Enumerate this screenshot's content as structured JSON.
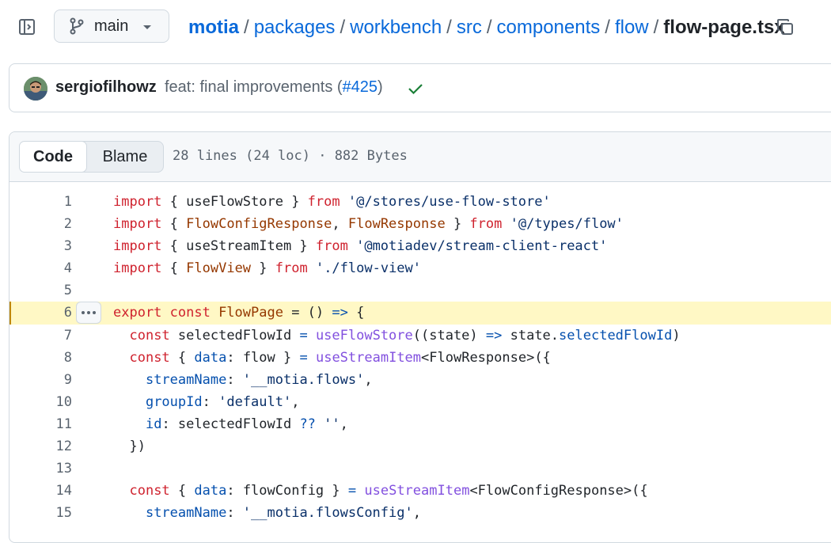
{
  "header": {
    "branch": "main",
    "breadcrumb": {
      "repo": "motia",
      "dirs": [
        "packages",
        "workbench",
        "src",
        "components",
        "flow"
      ],
      "file": "flow-page.tsx",
      "separator": "/"
    }
  },
  "commit": {
    "author": "sergiofilhowz",
    "message_prefix": "feat: final improvements (",
    "pr": "#425",
    "message_suffix": ")",
    "status": "success"
  },
  "file": {
    "tabs": [
      "Code",
      "Blame"
    ],
    "active_tab": "Code",
    "meta": "28 lines (24 loc) · 882 Bytes"
  },
  "code": {
    "highlighted_line": 6,
    "lines": [
      {
        "n": "1",
        "tokens": [
          [
            "kw",
            "import"
          ],
          [
            "",
            "{ useFlowStore } "
          ],
          [
            "kw",
            "from"
          ],
          [
            "",
            ""
          ],
          [
            "str",
            " '@/stores/use-flow-store'"
          ]
        ]
      },
      {
        "n": "2",
        "tokens": [
          [
            "kw",
            "import"
          ],
          [
            "",
            "{ "
          ],
          [
            "ent",
            "FlowConfigResponse"
          ],
          [
            "",
            ", "
          ],
          [
            "ent",
            "FlowResponse"
          ],
          [
            "",
            " } "
          ],
          [
            "kw",
            "from"
          ],
          [
            "str",
            " '@/types/flow'"
          ]
        ]
      },
      {
        "n": "3",
        "tokens": [
          [
            "kw",
            "import"
          ],
          [
            "",
            "{ useStreamItem } "
          ],
          [
            "kw",
            "from"
          ],
          [
            "str",
            " '@motiadev/stream-client-react'"
          ]
        ]
      },
      {
        "n": "4",
        "tokens": [
          [
            "kw",
            "import"
          ],
          [
            "",
            "{ "
          ],
          [
            "ent",
            "FlowView"
          ],
          [
            "",
            " } "
          ],
          [
            "kw",
            "from"
          ],
          [
            "str",
            " './flow-view'"
          ]
        ]
      },
      {
        "n": "5",
        "tokens": []
      },
      {
        "n": "6",
        "tokens": [
          [
            "kw",
            "export const "
          ],
          [
            "ent",
            "FlowPage"
          ],
          [
            "",
            " = () "
          ],
          [
            "op",
            "=>"
          ],
          [
            "",
            " {"
          ]
        ]
      },
      {
        "n": "7",
        "tokens": [
          [
            "",
            "  "
          ],
          [
            "kw",
            "const"
          ],
          [
            "",
            " selectedFlowId "
          ],
          [
            "op",
            "="
          ],
          [
            "",
            " "
          ],
          [
            "fn",
            "useFlowStore"
          ],
          [
            "",
            "((state) "
          ],
          [
            "op",
            "=>"
          ],
          [
            "",
            " state."
          ],
          [
            "prop",
            "selectedFlowId"
          ],
          [
            "",
            ")"
          ]
        ]
      },
      {
        "n": "8",
        "tokens": [
          [
            "",
            "  "
          ],
          [
            "kw",
            "const"
          ],
          [
            "",
            " { "
          ],
          [
            "prop",
            "data"
          ],
          [
            "",
            ": flow } "
          ],
          [
            "op",
            "="
          ],
          [
            "",
            " "
          ],
          [
            "fn",
            "useStreamItem"
          ],
          [
            "",
            "<FlowResponse>({"
          ]
        ]
      },
      {
        "n": "9",
        "tokens": [
          [
            "",
            "    "
          ],
          [
            "prop",
            "streamName"
          ],
          [
            "",
            ": "
          ],
          [
            "str",
            "'__motia.flows'"
          ],
          [
            "",
            ","
          ]
        ]
      },
      {
        "n": "10",
        "tokens": [
          [
            "",
            "    "
          ],
          [
            "prop",
            "groupId"
          ],
          [
            "",
            ": "
          ],
          [
            "str",
            "'default'"
          ],
          [
            "",
            ","
          ]
        ]
      },
      {
        "n": "11",
        "tokens": [
          [
            "",
            "    "
          ],
          [
            "prop",
            "id"
          ],
          [
            "",
            ": selectedFlowId "
          ],
          [
            "op",
            "??"
          ],
          [
            "",
            " "
          ],
          [
            "str",
            "''"
          ],
          [
            "",
            ","
          ]
        ]
      },
      {
        "n": "12",
        "tokens": [
          [
            "",
            "  })"
          ]
        ]
      },
      {
        "n": "13",
        "tokens": []
      },
      {
        "n": "14",
        "tokens": [
          [
            "",
            "  "
          ],
          [
            "kw",
            "const"
          ],
          [
            "",
            " { "
          ],
          [
            "prop",
            "data"
          ],
          [
            "",
            ": flowConfig } "
          ],
          [
            "op",
            "="
          ],
          [
            "",
            " "
          ],
          [
            "fn",
            "useStreamItem"
          ],
          [
            "",
            "<FlowConfigResponse>({"
          ]
        ]
      },
      {
        "n": "15",
        "tokens": [
          [
            "",
            "    "
          ],
          [
            "prop",
            "streamName"
          ],
          [
            "",
            ": "
          ],
          [
            "str",
            "'__motia.flowsConfig'"
          ],
          [
            "",
            ","
          ]
        ]
      }
    ]
  }
}
